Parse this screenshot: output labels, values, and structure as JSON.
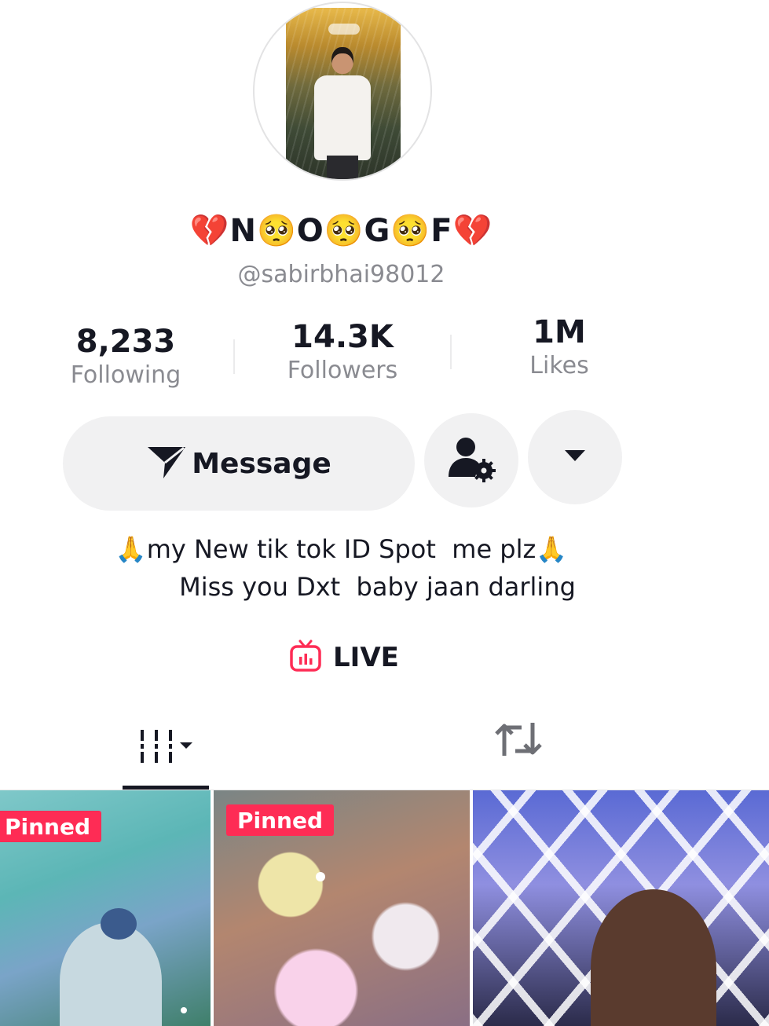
{
  "profile": {
    "display_name": "💔N🥺O🥺G🥺F💔",
    "username": "@sabirbhai98012"
  },
  "stats": {
    "following": {
      "value": "8,233",
      "label": "Following"
    },
    "followers": {
      "value": "14.3K",
      "label": "Followers"
    },
    "likes": {
      "value": "1M",
      "label": "Likes"
    }
  },
  "actions": {
    "message_label": "Message",
    "message_icon": "send-icon",
    "friend_settings_icon": "user-gear-icon",
    "more_icon": "caret-down-icon"
  },
  "bio": {
    "line1": "🙏my New tik tok ID Spot  me plz🙏",
    "line2": "Miss you Dxt  baby jaan darling"
  },
  "live": {
    "label": "LIVE",
    "icon": "live-tv-icon",
    "icon_color": "#fe2c55"
  },
  "tabs": [
    {
      "name": "videos",
      "icon": "grid-icon",
      "active": true
    },
    {
      "name": "reposts",
      "icon": "repost-icon",
      "active": false
    }
  ],
  "videos": [
    {
      "badge": "Pinned"
    },
    {
      "badge": "Pinned"
    },
    {
      "badge": ""
    }
  ],
  "colors": {
    "text": "#161823",
    "secondary": "#8a8b91",
    "button_bg": "#f1f1f2",
    "accent": "#fe2c55"
  }
}
